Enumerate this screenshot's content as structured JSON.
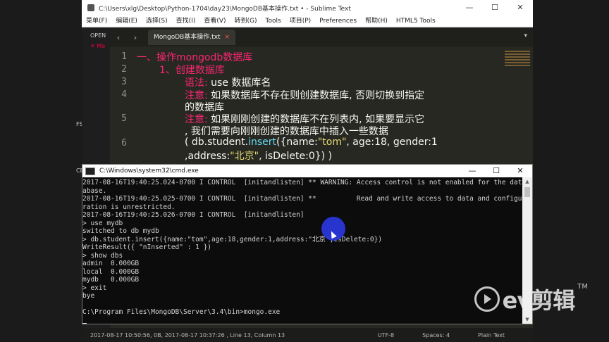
{
  "sublime": {
    "title": "C:\\Users\\xlg\\Desktop\\Python-1704\\day23\\MongoDB基本操作.txt • - Sublime Text",
    "menu": [
      "菜单(F)",
      "编辑(E)",
      "选择(S)",
      "查找(I)",
      "查看(V)",
      "转到(G)",
      "Tools",
      "项目(P)",
      "Preferences",
      "帮助(H)",
      "HTML5 Tools"
    ],
    "sidebar_open": "OPEN",
    "sidebar_file": "✕ Mo",
    "tab_label": "MongoDB基本操作.txt",
    "code": {
      "l1_label": "一、操作mongodb数据库",
      "l2_label": "1、创建数据库",
      "l3_kw": "语法:",
      "l3_text": " use 数据库名",
      "l4_kw": "注意:",
      "l4_text": " 如果数据库不存在则创建数据库, 否则切换到指定",
      "l4b_text": "的数据库",
      "l5_kw": "注意:",
      "l5_text": " 如果刚刚创建的数据库不在列表内, 如果要显示它",
      "l5b_text": ", 我们需要向刚刚创建的数据库中插入一些数据",
      "l6_a": "(    db.student.",
      "l6_fn": "insert",
      "l6_b": "({name:",
      "l6_str1": "\"tom\"",
      "l6_c": ", age:18, gender:1",
      "l6b_a": ",address:",
      "l6b_str2": "\"北京\"",
      "l6b_b": ", isDelete:0})   )"
    },
    "line_numbers": [
      "1",
      "2",
      "3",
      "4",
      "5",
      "6"
    ],
    "status_left": "2017-08-17 10:50:56, 0B, 2017-08-17 10:37:26 , Line 13, Column 13",
    "status_encoding": "UTF-8",
    "status_spaces": "Spaces: 4",
    "status_syntax": "Plain Text"
  },
  "cmd": {
    "title": "C:\\Windows\\system32\\cmd.exe",
    "lines": [
      "2017-08-16T19:40:25.024-0700 I CONTROL  [initandlisten] ** WARNING: Access control is not enabled for the dat",
      "abase.",
      "2017-08-16T19:40:25.025-0700 I CONTROL  [initandlisten] **          Read and write access to data and configu",
      "ration is unrestricted.",
      "2017-08-16T19:40:25.026-0700 I CONTROL  [initandlisten]",
      "> use mydb",
      "switched to db mydb",
      "> db.student.insert({name:\"tom\",age:18,gender:1,address:\"北京\",isDelete:0})",
      "WriteResult({ \"nInserted\" : 1 })",
      "> show dbs",
      "admin  0.000GB",
      "local  0.000GB",
      "mydb   0.000GB",
      "> exit",
      "bye",
      "",
      "C:\\Program Files\\MongoDB\\Server\\3.4\\bin>mongo.exe"
    ]
  },
  "desktop": {
    "fs_label": "FS",
    "ce_label": "CE"
  },
  "watermark": {
    "text": "ev剪辑",
    "tm": "TM"
  }
}
